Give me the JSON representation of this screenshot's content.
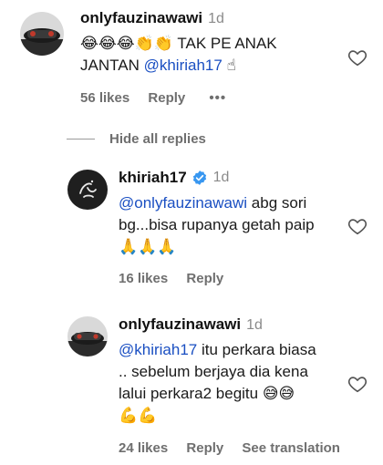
{
  "comment": {
    "username": "onlyfauzinawawi",
    "time": "1d",
    "text_line1_emojis": "😂😂😂👏👏",
    "text_line1_rest": "TAK PE ANAK",
    "text_line2_start": "JANTAN",
    "text_line2_mention": "@khiriah17",
    "text_line2_emoji": "☝",
    "likes": "56 likes",
    "reply": "Reply",
    "more": "•••"
  },
  "hide_replies": "Hide all replies",
  "replies": [
    {
      "username": "khiriah17",
      "time": "1d",
      "verified": true,
      "mention": "@onlyfauzinawawi",
      "text_line1_rest": "abg sori",
      "text_line2": "bg...bisa rupanya getah paip",
      "text_line3": "🙏🙏🙏",
      "likes": "16 likes",
      "reply": "Reply"
    },
    {
      "username": "onlyfauzinawawi",
      "time": "1d",
      "mention": "@khiriah17",
      "text_line1_rest": "itu perkara biasa",
      "text_line2": ".. sebelum berjaya dia kena",
      "text_line3": "lalui perkara2 begitu 😅😅",
      "text_line4": "💪💪",
      "likes": "24 likes",
      "reply": "Reply",
      "see_translation": "See translation"
    }
  ],
  "colors": {
    "mention": "#1a4fc2",
    "verified": "#3897f0",
    "meta": "#6f6f6f"
  }
}
